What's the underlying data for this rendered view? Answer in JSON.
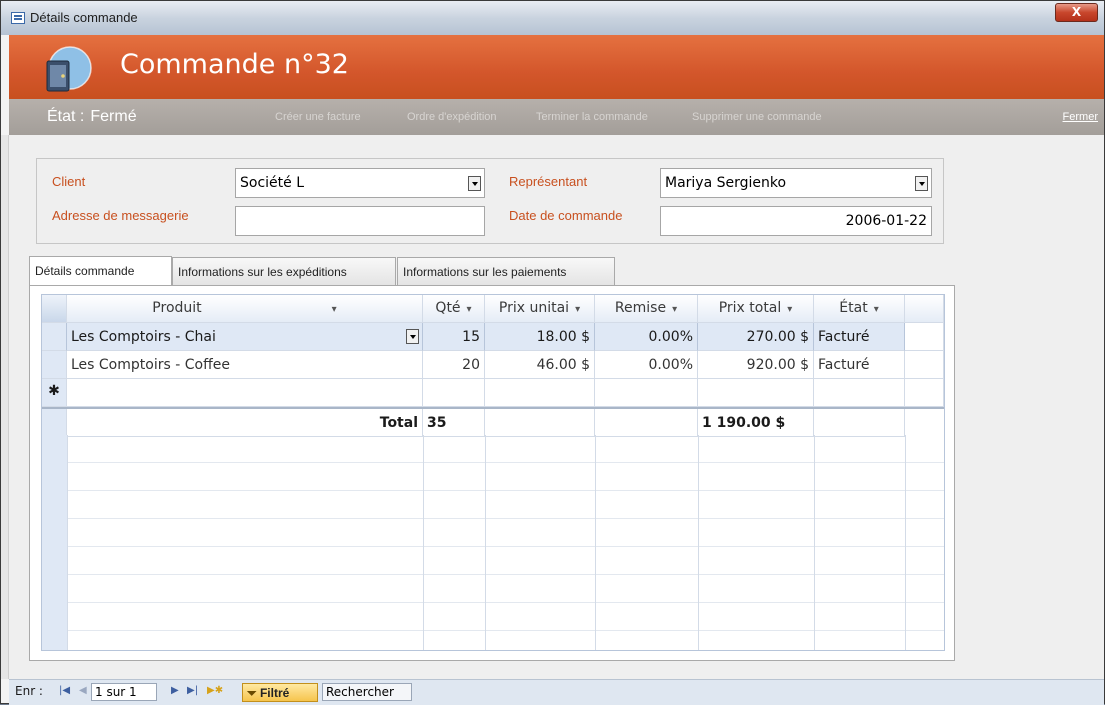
{
  "window": {
    "title": "Détails commande",
    "close": "X"
  },
  "header": {
    "title": "Commande n°32"
  },
  "toolbar": {
    "etat_label": "État :",
    "etat_value": "Fermé",
    "actions": [
      "Créer une facture",
      "Ordre d'expédition",
      "Terminer la commande",
      "Supprimer une commande"
    ],
    "close": "Fermer"
  },
  "fields": {
    "client_label": "Client",
    "client_value": "Société L",
    "adresse_label": "Adresse de messagerie",
    "adresse_value": "",
    "representant_label": "Représentant",
    "representant_value": "Mariya Sergienko",
    "date_label": "Date de commande",
    "date_value": "2006-01-22"
  },
  "tabs": [
    "Détails commande",
    "Informations sur les expéditions",
    "Informations sur les paiements"
  ],
  "grid": {
    "headers": [
      "Produit",
      "Qté",
      "Prix unitai",
      "Remise",
      "Prix total",
      "État"
    ],
    "rows": [
      [
        "Les Comptoirs - Chai",
        "15",
        "18.00 $",
        "0.00%",
        "270.00 $",
        "Facturé"
      ],
      [
        "Les Comptoirs - Coffee",
        "20",
        "46.00 $",
        "0.00%",
        "920.00 $",
        "Facturé"
      ]
    ],
    "new_row_marker": "✱",
    "total_label": "Total",
    "total_qty": "35",
    "total_price": "1 190.00 $"
  },
  "statusbar": {
    "record_label": "Enr :",
    "record_value": "1 sur 1",
    "filter": "Filtré",
    "search": "Rechercher"
  }
}
